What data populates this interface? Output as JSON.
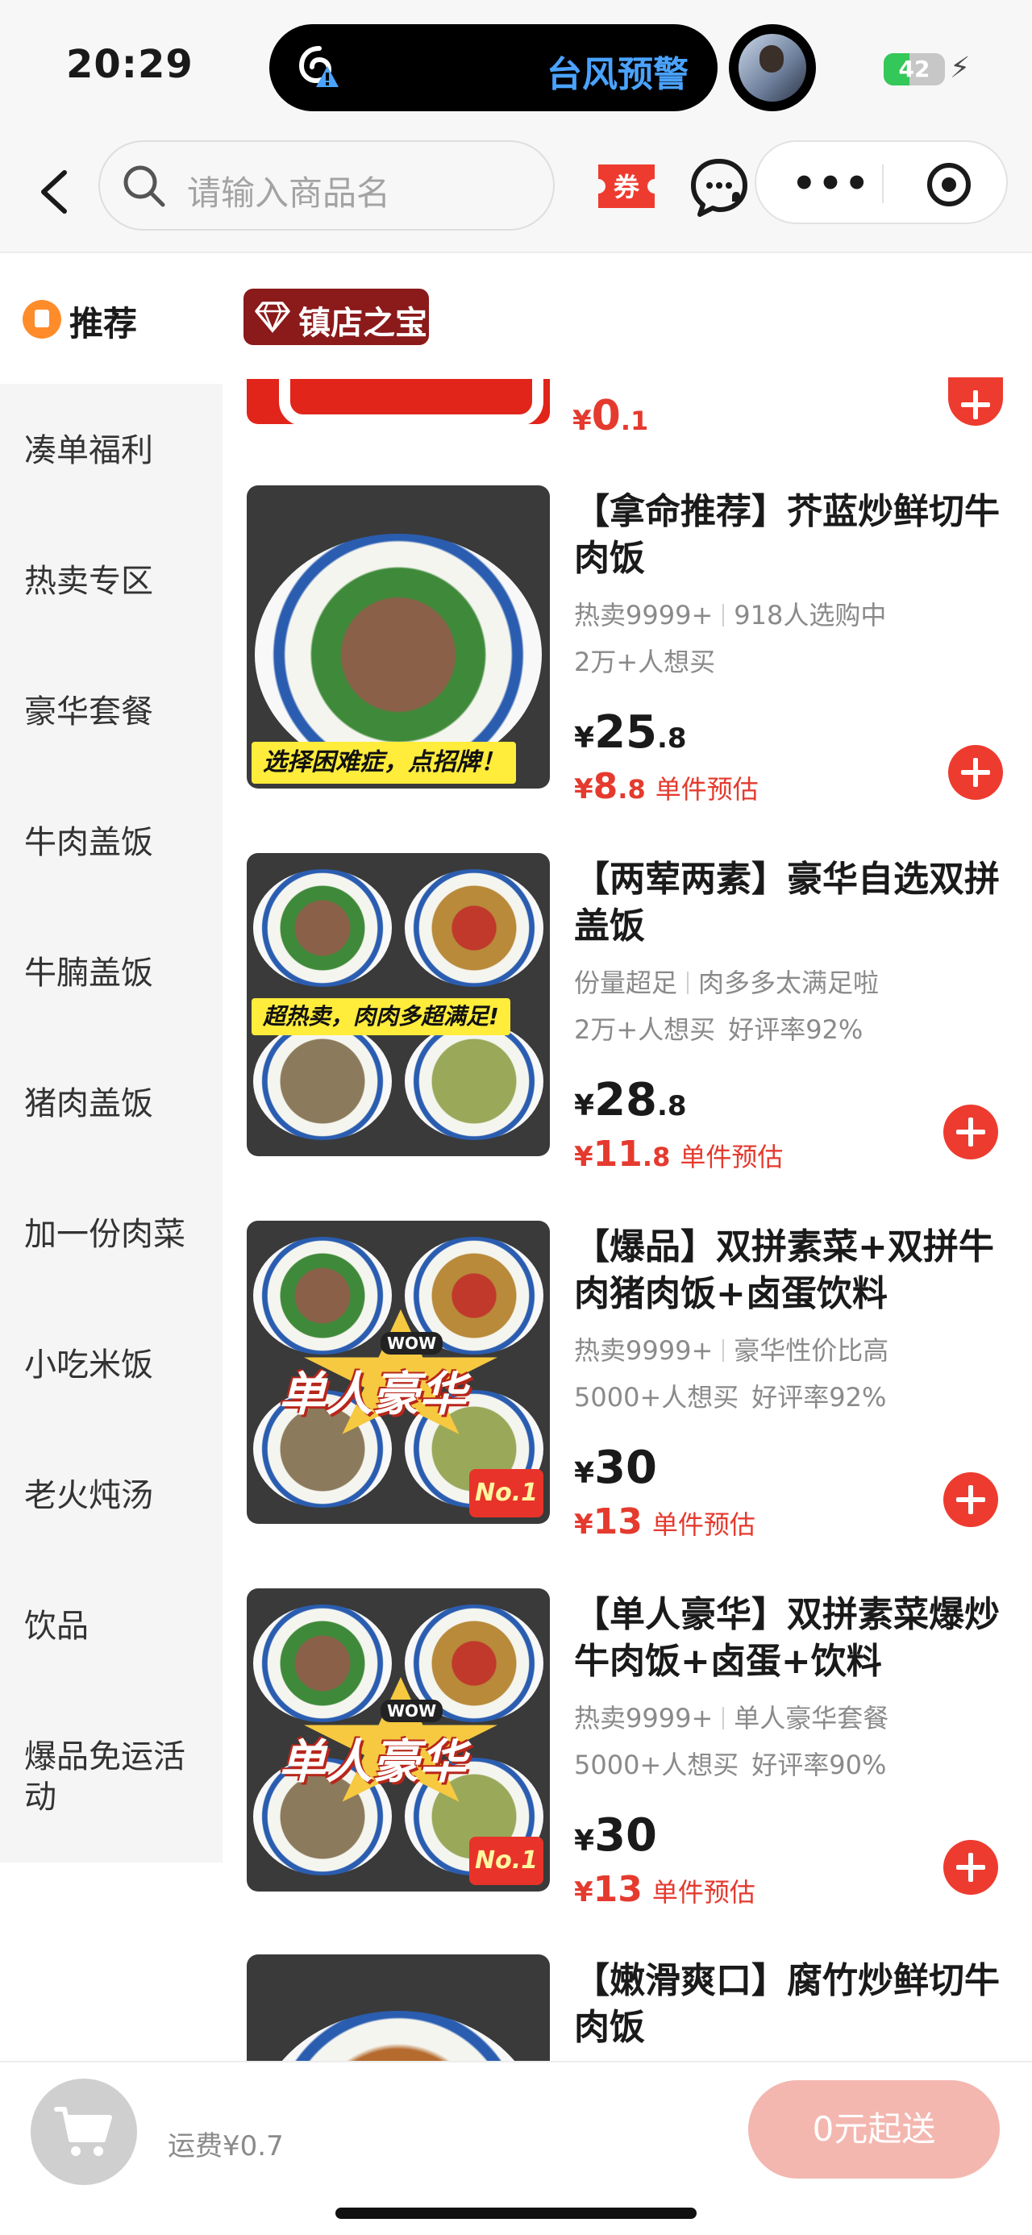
{
  "status_bar": {
    "time": "20:29",
    "alert_text": "台风预警",
    "battery": "42",
    "battery_level": 0.42,
    "icons": [
      "typhoon-warning-icon",
      "avatar",
      "charging-bolt-icon"
    ]
  },
  "nav": {
    "search_placeholder": "请输入商品名",
    "more_label": "•••",
    "icons": [
      "back-icon",
      "search-icon",
      "coupon-icon",
      "chat-icon",
      "more-icon",
      "target-icon"
    ]
  },
  "coupon_label": "券",
  "sidebar": {
    "recommend": "推荐",
    "items": [
      {
        "label": "凑单福利"
      },
      {
        "label": "热卖专区"
      },
      {
        "label": "豪华套餐"
      },
      {
        "label": "牛肉盖饭"
      },
      {
        "label": "牛腩盖饭"
      },
      {
        "label": "猪肉盖饭"
      },
      {
        "label": "加一份肉菜"
      },
      {
        "label": "小吃米饭"
      },
      {
        "label": "老火炖汤"
      },
      {
        "label": "饮品"
      },
      {
        "label": "爆品免运活动"
      }
    ]
  },
  "section_badge": "镇店之宝",
  "previous_item": {
    "price_currency": "¥",
    "price_int": "0",
    "price_dec": ".1"
  },
  "products": [
    {
      "title": "【拿命推荐】芥蓝炒鲜切牛肉饭",
      "tag1": "热卖9999+",
      "tag2": "918人选购中",
      "meta1": "2万+人想买",
      "meta2": "",
      "price_currency": "¥",
      "price_int": "25",
      "price_dec": ".8",
      "est_currency": "¥",
      "est_int": "8",
      "est_dec": ".8",
      "est_label": "单件预估",
      "img_banner": "选择困难症，点招牌！"
    },
    {
      "title": "【两荤两素】豪华自选双拼盖饭",
      "tag1": "份量超足",
      "tag2": "肉多多太满足啦",
      "meta1": "2万+人想买",
      "meta2": "好评率92%",
      "price_currency": "¥",
      "price_int": "28",
      "price_dec": ".8",
      "est_currency": "¥",
      "est_int": "11",
      "est_dec": ".8",
      "est_label": "单件预估",
      "img_banner": "超热卖，肉肉多超满足!"
    },
    {
      "title": "【爆品】双拼素菜+双拼牛肉猪肉饭+卤蛋饮料",
      "tag1": "热卖9999+",
      "tag2": "豪华性价比高",
      "meta1": "5000+人想买",
      "meta2": "好评率92%",
      "price_currency": "¥",
      "price_int": "30",
      "price_dec": "",
      "est_currency": "¥",
      "est_int": "13",
      "est_dec": "",
      "est_label": "单件预估",
      "img_promo": "单人豪华",
      "img_wow": "WOW",
      "img_no1": "No.1"
    },
    {
      "title": "【单人豪华】双拼素菜爆炒牛肉饭+卤蛋+饮料",
      "tag1": "热卖9999+",
      "tag2": "单人豪华套餐",
      "meta1": "5000+人想买",
      "meta2": "好评率90%",
      "price_currency": "¥",
      "price_int": "30",
      "price_dec": "",
      "est_currency": "¥",
      "est_int": "13",
      "est_dec": "",
      "est_label": "单件预估",
      "img_promo": "单人豪华",
      "img_wow": "WOW",
      "img_no1": "No.1"
    },
    {
      "title": "【嫩滑爽口】腐竹炒鲜切牛肉饭"
    }
  ],
  "bottom_bar": {
    "delivery_fee": "运费¥0.7",
    "checkout_label": "0元起送"
  },
  "colors": {
    "accent_red": "#ee3b2f",
    "price_red": "#e53a2e",
    "badge_dark_red": "#8b1a1a",
    "checkout_disabled": "#f3b7b0",
    "sidebar_bg": "#f5f5f5"
  }
}
